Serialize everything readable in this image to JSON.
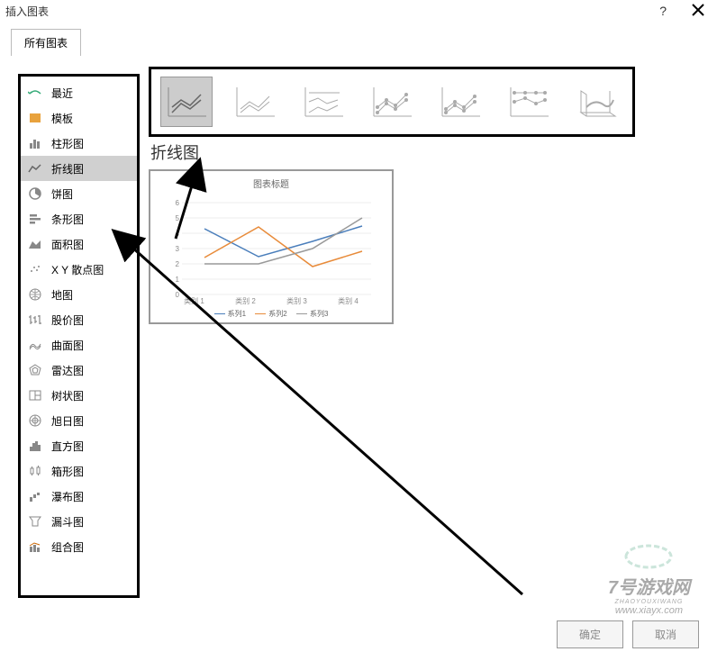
{
  "dialog": {
    "title": "插入图表",
    "help": "?",
    "tab": "所有图表"
  },
  "sidebar": {
    "items": [
      {
        "label": "最近"
      },
      {
        "label": "模板"
      },
      {
        "label": "柱形图"
      },
      {
        "label": "折线图"
      },
      {
        "label": "饼图"
      },
      {
        "label": "条形图"
      },
      {
        "label": "面积图"
      },
      {
        "label": "X Y 散点图"
      },
      {
        "label": "地图"
      },
      {
        "label": "股价图"
      },
      {
        "label": "曲面图"
      },
      {
        "label": "雷达图"
      },
      {
        "label": "树状图"
      },
      {
        "label": "旭日图"
      },
      {
        "label": "直方图"
      },
      {
        "label": "箱形图"
      },
      {
        "label": "瀑布图"
      },
      {
        "label": "漏斗图"
      },
      {
        "label": "组合图"
      }
    ],
    "selectedIndex": 3
  },
  "chartTypeLabel": "折线图",
  "preview": {
    "title": "图表标题",
    "xcats": [
      "类别 1",
      "类别 2",
      "类别 3",
      "类别 4"
    ],
    "legend": [
      "系列1",
      "系列2",
      "系列3"
    ]
  },
  "buttons": {
    "ok": "确定",
    "cancel": "取消"
  },
  "watermark": {
    "line1": "7号游戏网",
    "sub": "ZHAOYOUXIWANG",
    "url": "www.xiayx.com"
  },
  "chart_data": {
    "type": "line",
    "title": "图表标题",
    "categories": [
      "类别 1",
      "类别 2",
      "类别 3",
      "类别 4"
    ],
    "series": [
      {
        "name": "系列1",
        "values": [
          4.3,
          2.5,
          3.5,
          4.5
        ],
        "color": "#4a7ebb"
      },
      {
        "name": "系列2",
        "values": [
          2.4,
          4.4,
          1.8,
          2.8
        ],
        "color": "#e88b3a"
      },
      {
        "name": "系列3",
        "values": [
          2.0,
          2.0,
          3.0,
          5.0
        ],
        "color": "#999999"
      }
    ],
    "ylabel": "",
    "xlabel": "",
    "ylim": [
      0,
      6
    ],
    "yticks": [
      0,
      1,
      2,
      3,
      4,
      5,
      6
    ]
  }
}
